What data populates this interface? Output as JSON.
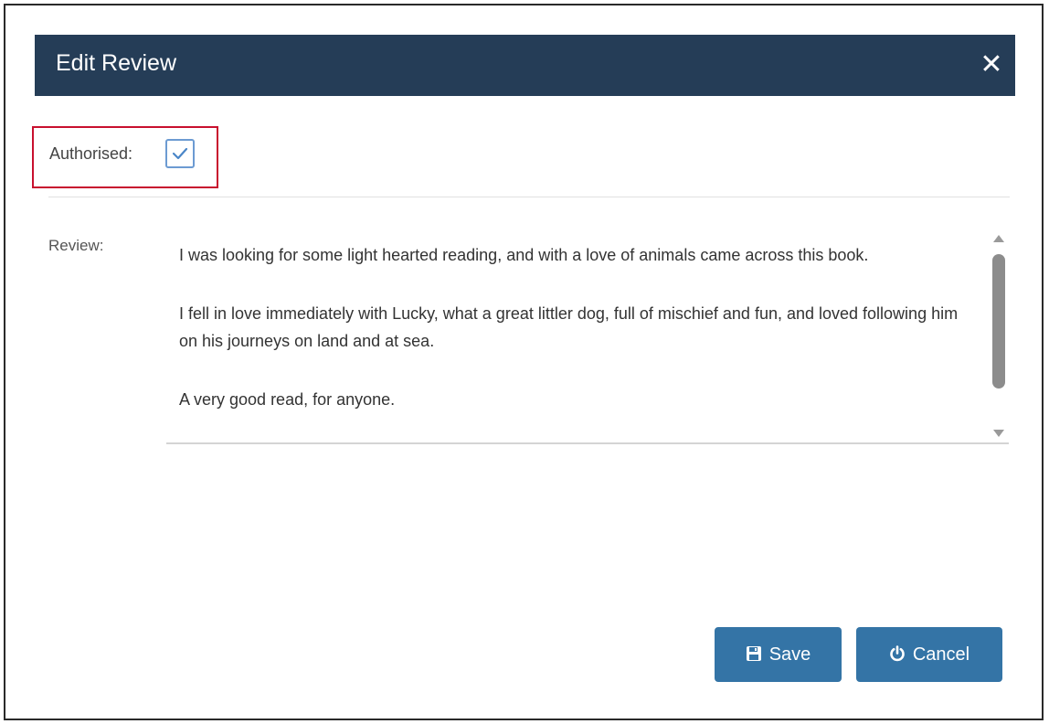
{
  "dialog": {
    "title": "Edit Review",
    "close_glyph": "✕"
  },
  "authorised": {
    "label": "Authorised:",
    "checked": true
  },
  "review": {
    "label": "Review:",
    "paragraphs": [
      "I was looking for some light hearted reading, and with a love of animals came across this book.",
      "I fell in love immediately with Lucky,  what a great littler dog,  full of mischief and fun, and loved following him on his journeys on land and at sea.",
      "A very good read,  for anyone."
    ]
  },
  "buttons": {
    "save_label": "Save",
    "save_icon": "floppy-disk-icon",
    "cancel_label": "Cancel",
    "cancel_icon": "power-icon"
  },
  "colors": {
    "header": "#253d57",
    "button": "#3474a6",
    "highlight": "#c8102e",
    "checkbox_border": "#6c9bd2"
  }
}
